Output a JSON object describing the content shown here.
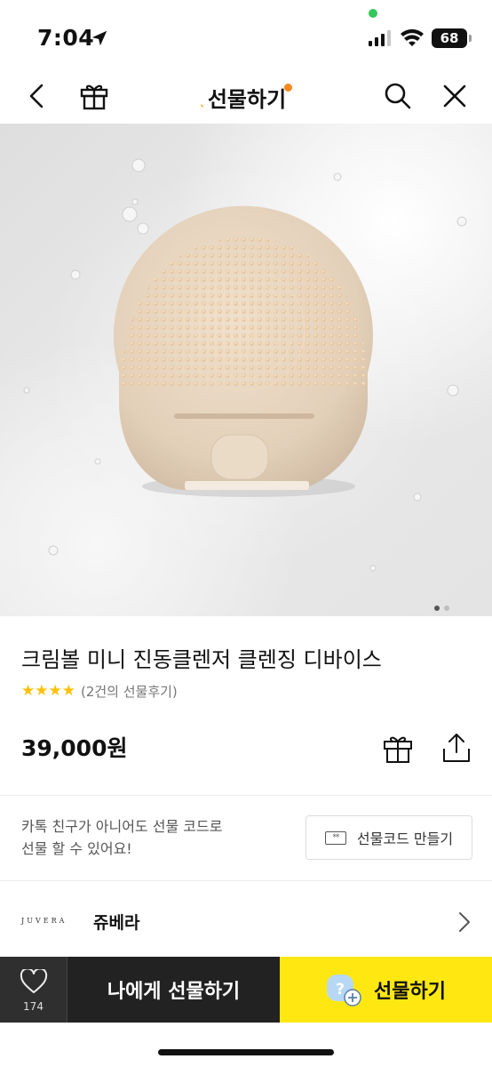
{
  "status_bar": {
    "time": "7:04",
    "battery": "68"
  },
  "nav": {
    "brand_title": "선물하기"
  },
  "product": {
    "title": "크림볼 미니 진동클렌저 클렌징 디바이스",
    "stars": "★★★★",
    "review_text": "(2건의 선물후기)",
    "price": "39,000원",
    "rating": 4
  },
  "gift_code": {
    "desc_line1": "카톡 친구가 아니어도 선물 코드로",
    "desc_line2": "선물 할 수 있어요!",
    "button_label": "선물코드 만들기",
    "button_icon_text": "**"
  },
  "brand": {
    "logo_text": "JUVERA",
    "name": "쥬베라"
  },
  "bottom_bar": {
    "like_count": "174",
    "self_gift_label": "나에게 선물하기",
    "gift_label": "선물하기"
  },
  "carousel": {
    "total": 2,
    "current": 1
  },
  "colors": {
    "accent_yellow": "#ffe812",
    "star": "#ffc107",
    "dark": "#222222"
  },
  "icons": [
    "back-icon",
    "gift-icon",
    "search-icon",
    "close-icon",
    "share-icon",
    "heart-icon",
    "chevron-right-icon",
    "location-arrow-icon",
    "signal-icon",
    "wifi-icon"
  ]
}
